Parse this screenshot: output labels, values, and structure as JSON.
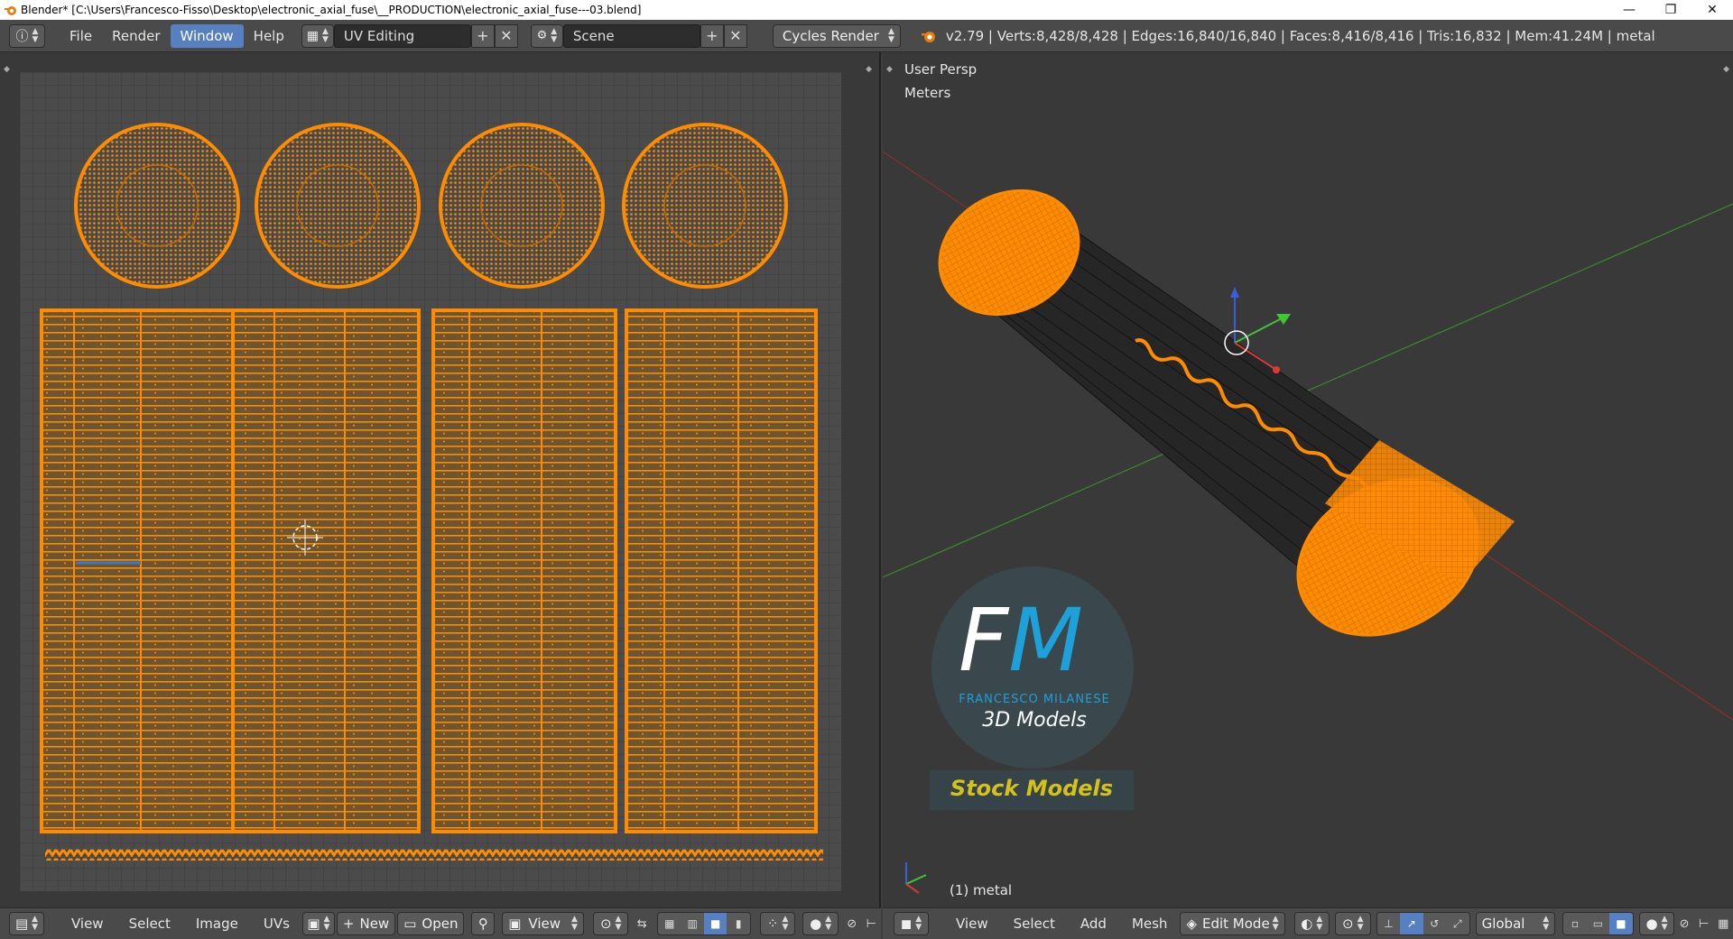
{
  "window": {
    "title": "Blender* [C:\\Users\\Francesco-Fisso\\Desktop\\electronic_axial_fuse\\__PRODUCTION\\electronic_axial_fuse---03.blend]",
    "minimize": "—",
    "restore": "❐",
    "close": "✕"
  },
  "topbar": {
    "menus": [
      "File",
      "Render",
      "Window",
      "Help"
    ],
    "active_menu": "Window",
    "screen_layout": "UV Editing",
    "scene": "Scene",
    "render_engine": "Cycles Render",
    "stats": "v2.79 | Verts:8,428/8,428 | Edges:16,840/16,840 | Faces:8,416/8,416 | Tris:16,832 | Mem:41.24M | metal"
  },
  "viewport": {
    "view_name": "User Persp",
    "units": "Meters",
    "object_label": "(1) metal"
  },
  "watermark": {
    "monogram_f": "F",
    "monogram_m": "M",
    "name": "FRANCESCO MILANESE",
    "tagline": "3D Models",
    "stock": "Stock Models"
  },
  "uv_bottombar": {
    "menus": [
      "View",
      "Select",
      "Image",
      "UVs"
    ],
    "new_label": "New",
    "open_label": "Open",
    "view_label": "View"
  },
  "vp_bottombar": {
    "menus": [
      "View",
      "Select",
      "Add",
      "Mesh"
    ],
    "mode": "Edit Mode",
    "orientation": "Global"
  },
  "colors": {
    "mesh_orange": "#ff8c00",
    "selection_blue": "#5680c2",
    "background": "#393939",
    "header": "#4a4a4a",
    "stock_text": "#d4c21a",
    "fm_blue": "#1ea0d8"
  }
}
